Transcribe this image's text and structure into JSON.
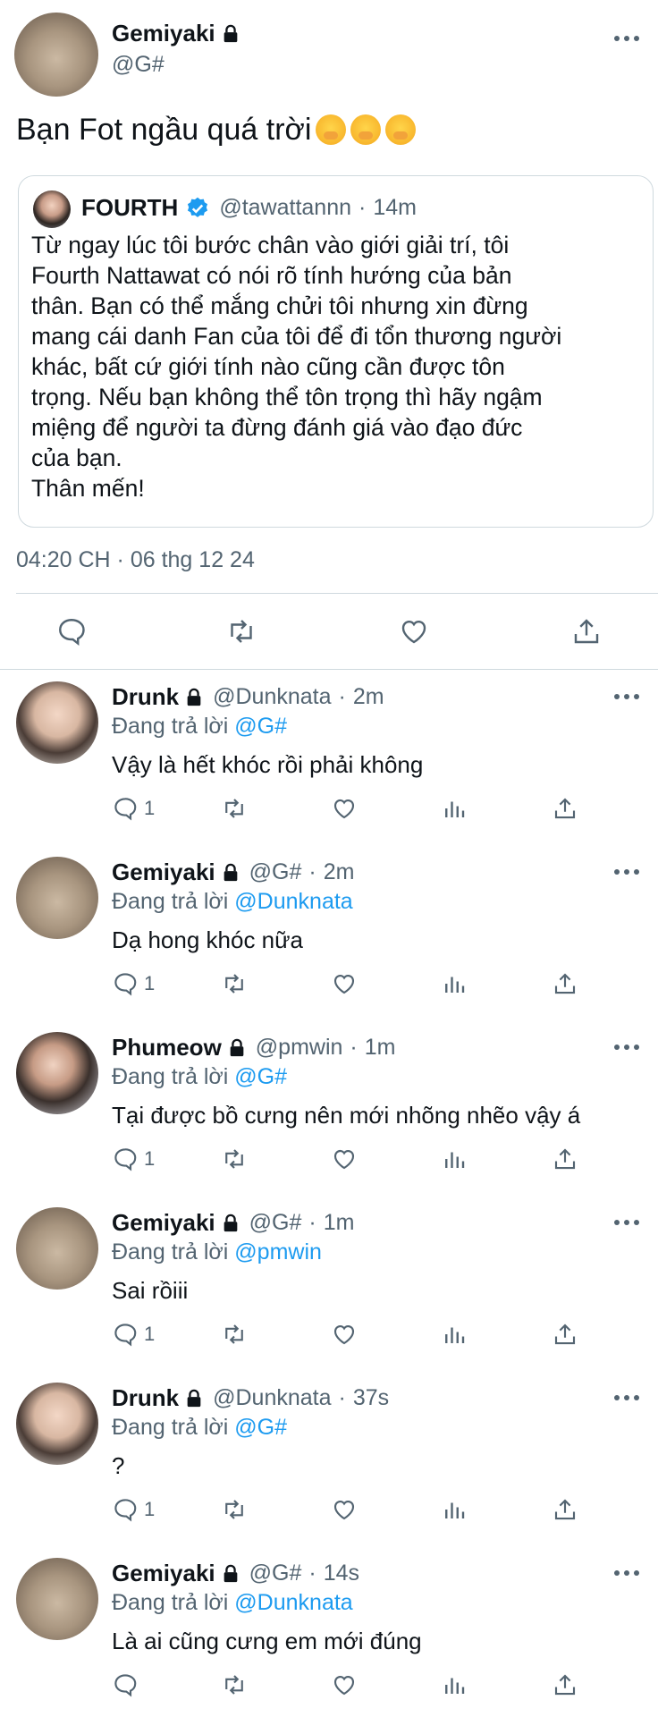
{
  "main_tweet": {
    "author": {
      "name": "Gemiyaki",
      "handle": "@G#"
    },
    "text": "Bạn Fot ngầu quá trời",
    "emojis": [
      "face-with-hand-over-mouth",
      "face-with-hand-over-mouth",
      "face-with-hand-over-mouth"
    ],
    "quoted": {
      "name": "FOURTH",
      "handle": "@tawattannn",
      "time": "14m",
      "text": "Từ ngay lúc tôi bước chân vào giới giải trí, tôi\nFourth Nattawat có nói rõ tính hướng của bản\nthân. Bạn có thể mắng chửi tôi nhưng xin đừng\nmang cái danh Fan của tôi để đi tổn thương người\nkhác, bất cứ giới tính nào cũng cần được tôn\ntrọng. Nếu bạn không thể tôn trọng thì hãy ngậm\nmiệng để người ta đừng đánh giá vào đạo đức\ncủa bạn.\nThân mến!"
    },
    "timestamp": "04:20 CH · 06 thg 12 24"
  },
  "icons": {
    "lock": "lock-icon",
    "verified": "verified-badge-icon",
    "more": "more-horizontal-icon",
    "reply": "comment-icon",
    "retweet": "retweet-icon",
    "like": "heart-icon",
    "views": "bar-chart-icon",
    "share": "share-icon"
  },
  "colors": {
    "accent": "#1d9bf0",
    "secondary_text": "#536471",
    "border": "#cfd9de"
  },
  "replying_prefix": "Đang trả lời",
  "replies": [
    {
      "name": "Drunk",
      "handle": "@Dunknata",
      "time": "2m",
      "replying_to": "@G#",
      "text": "Vậy là hết khóc rồi phải không",
      "reply_count": "1"
    },
    {
      "name": "Gemiyaki",
      "handle": "@G#",
      "time": "2m",
      "replying_to": "@Dunknata",
      "text": "Dạ hong khóc nữa",
      "reply_count": "1"
    },
    {
      "name": "Phumeow",
      "handle": "@pmwin",
      "time": "1m",
      "replying_to": "@G#",
      "text": "Tại được bồ cưng nên mới nhõng nhẽo vậy á",
      "reply_count": "1"
    },
    {
      "name": "Gemiyaki",
      "handle": "@G#",
      "time": "1m",
      "replying_to": "@pmwin",
      "text": "Sai rồiii",
      "reply_count": "1"
    },
    {
      "name": "Drunk",
      "handle": "@Dunknata",
      "time": "37s",
      "replying_to": "@G#",
      "text": "?",
      "reply_count": "1"
    },
    {
      "name": "Gemiyaki",
      "handle": "@G#",
      "time": "14s",
      "replying_to": "@Dunknata",
      "text": "Là ai cũng cưng em mới đúng",
      "reply_count": ""
    }
  ]
}
